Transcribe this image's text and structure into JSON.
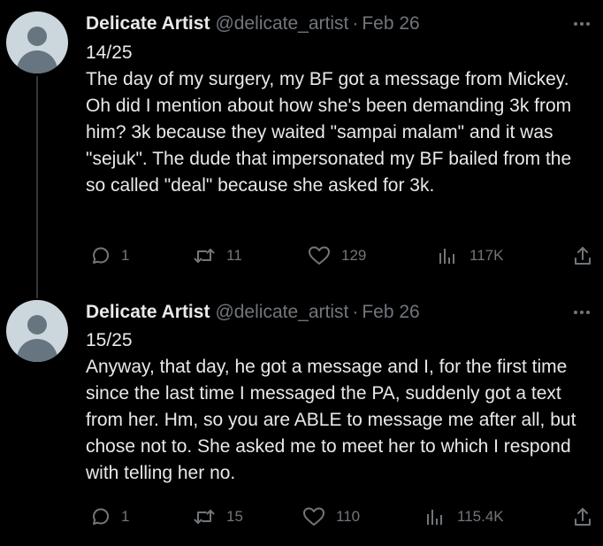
{
  "colors": {
    "background": "#000000",
    "text_primary": "#e7e9ea",
    "text_secondary": "#71767b",
    "avatar_bg": "#ccd6dd",
    "avatar_fg": "#66757f",
    "thread_line": "#333639"
  },
  "tweets": [
    {
      "display_name": "Delicate Artist",
      "handle": "@delicate_artist",
      "separator": "·",
      "date": "Feb 26",
      "text": "14/25\nThe day of my surgery, my BF got a message from Mickey. Oh did I mention about how she's been demanding 3k from him? 3k because they waited \"sampai malam\" and it was \"sejuk\". The dude that impersonated my BF bailed from the so called \"deal\" because she asked for 3k.",
      "replies": "1",
      "retweets": "11",
      "likes": "129",
      "views": "117K",
      "icons": {
        "avatar": "default-avatar-icon",
        "more": "more-icon",
        "reply": "reply-icon",
        "retweet": "retweet-icon",
        "like": "heart-icon",
        "views": "views-icon",
        "share": "share-icon"
      }
    },
    {
      "display_name": "Delicate Artist",
      "handle": "@delicate_artist",
      "separator": "·",
      "date": "Feb 26",
      "text": "15/25\nAnyway, that day, he got a message and I, for the first time since the last time I messaged the PA, suddenly got a text from her. Hm, so you are ABLE to message me after all, but chose not to. She asked me to meet her to which I respond with telling her no.",
      "replies": "1",
      "retweets": "15",
      "likes": "110",
      "views": "115.4K",
      "icons": {
        "avatar": "default-avatar-icon",
        "more": "more-icon",
        "reply": "reply-icon",
        "retweet": "retweet-icon",
        "like": "heart-icon",
        "views": "views-icon",
        "share": "share-icon"
      }
    }
  ]
}
